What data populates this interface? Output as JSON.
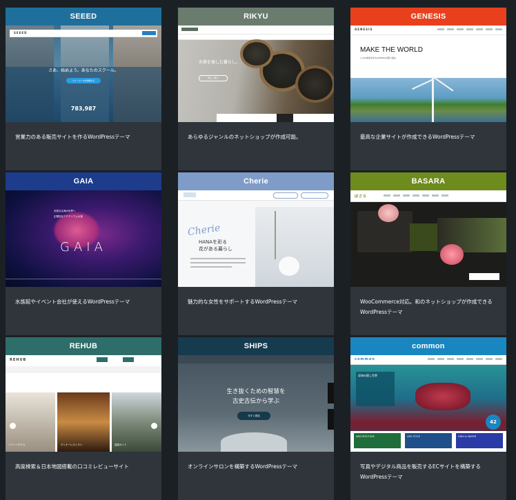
{
  "cards": [
    {
      "title": "SEEED",
      "color": "#1f6f9c",
      "desc": "営業力のある販売サイトを作るWordPressテーマ",
      "shot": {
        "tagline": "さあ、始めよう。あなたのスクール。",
        "button": "フリーコースを体験する",
        "count": "783,987",
        "logo": "SEEED"
      }
    },
    {
      "title": "RIKYU",
      "color": "#6a7c6e",
      "desc": "あらゆるジャンルのネットショップが作成可能。",
      "shot": {
        "tagline": "お茶を愉しむ暮らし。",
        "button": "詳しく見る"
      }
    },
    {
      "title": "GENESIS",
      "color": "#e8401c",
      "desc": "最高な企業サイトが作成できるWordPressテーマ",
      "shot": {
        "logo": "GENESIS",
        "heading": "MAKE THE WORLD",
        "sub": "人々の未来を作るGENESISの取り組み"
      }
    },
    {
      "title": "GAIA",
      "color": "#1d3c8c",
      "desc": "水族館やイベント会社が使えるWordPressテーマ",
      "shot": {
        "logo": "GAIA",
        "line1": "未知なる海の世界へ",
        "line2": "幻想的なアクアリウムの旅"
      }
    },
    {
      "title": "Cherie",
      "color": "#7e9cc7",
      "desc": "魅力的な女性をサポートするWordPressテーマ",
      "shot": {
        "script": "Cherie",
        "line1": "HANAを彩る",
        "line2": "花がある暮らし"
      }
    },
    {
      "title": "BASARA",
      "color": "#6e8b1e",
      "desc": "WooCommerce対応。和のネットショップが作成できるWordPressテーマ",
      "shot": {
        "logo": "ばさら"
      }
    },
    {
      "title": "REHUB",
      "color": "#2d6e6a",
      "desc": "高度検索＆日本地図搭載の口コミレビューサイト",
      "shot": {
        "logo": "REHUB",
        "card1": "リゾートホテル",
        "card2": "ディナーレストラン",
        "card3": "温泉ガイド"
      }
    },
    {
      "title": "SHIPS",
      "color": "#163a4e",
      "desc": "オンラインサロンを構築するWordPressテーマ",
      "shot": {
        "line1": "生き抜くための智慧を",
        "line2": "古史古伝から学ぶ",
        "button": "今すぐ参加"
      }
    },
    {
      "title": "common",
      "color": "#1a86bf",
      "desc": "写真やデジタル商品を販売するECサイトを構築するWordPressテーマ",
      "shot": {
        "logo": "common",
        "box": "深海の癒し世界",
        "tile1": "ARCHITECTURE",
        "tile2": "LIFE STYLE",
        "tile3": "HIGH & WATER",
        "badge": "42"
      }
    }
  ]
}
